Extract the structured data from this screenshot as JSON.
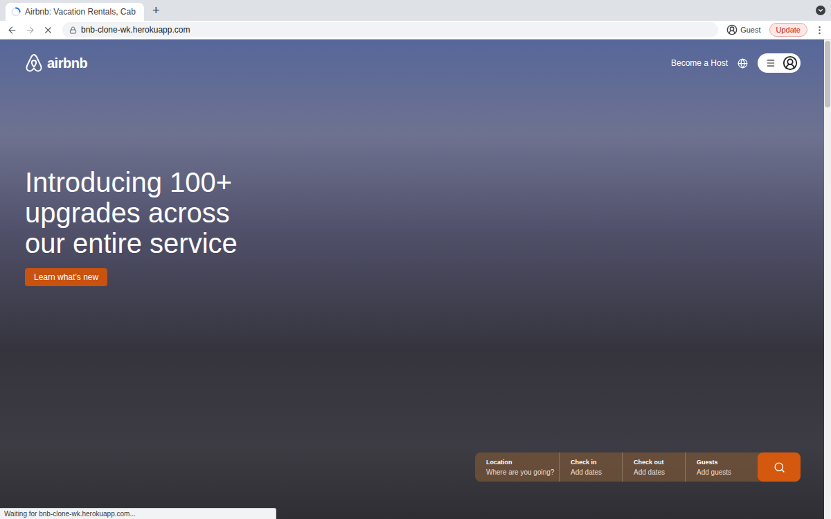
{
  "browser": {
    "tab": {
      "title": "Airbnb: Vacation Rentals, Cab",
      "loading": true
    },
    "new_tab": "+",
    "address": "bnb-clone-wk.herokuapp.com",
    "profile": "Guest",
    "update_button": "Update",
    "status": "Waiting for bnb-clone-wk.herokuapp.com..."
  },
  "header": {
    "logo": "airbnb",
    "links": [
      "Become a Host"
    ]
  },
  "hero": {
    "title_lines": [
      "Introducing 100+",
      "upgrades across",
      "our entire service"
    ],
    "button": "Learn what’s new"
  },
  "search": {
    "fields": [
      {
        "label": "Location",
        "placeholder": "Where are you going?"
      },
      {
        "label": "Check in",
        "placeholder": "Add dates"
      },
      {
        "label": "Check out",
        "placeholder": "Add dates"
      },
      {
        "label": "Guests",
        "placeholder": "Add guests"
      }
    ]
  }
}
